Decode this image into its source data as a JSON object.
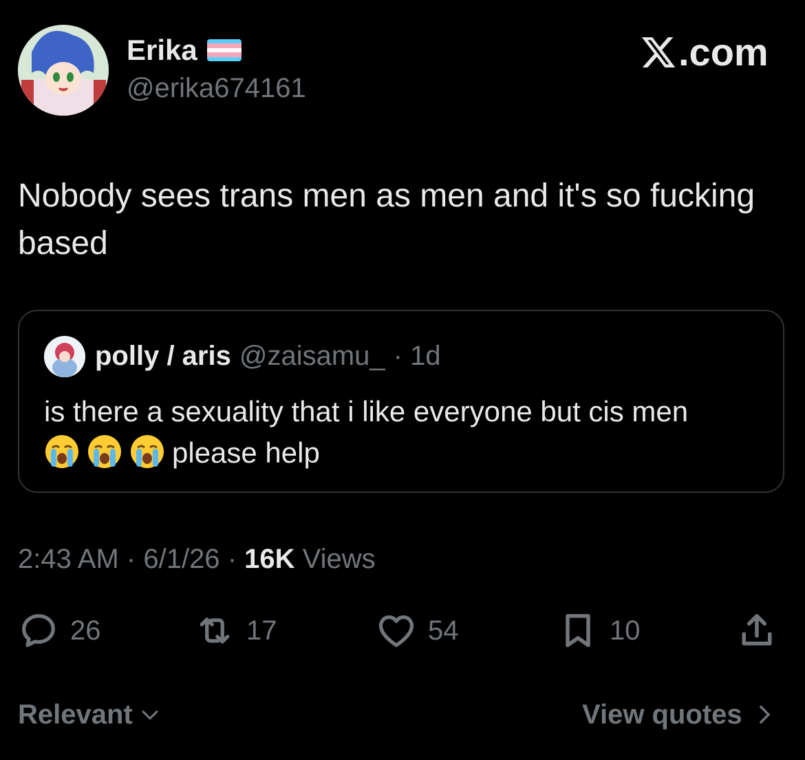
{
  "author": {
    "name": "Erika",
    "handle": "@erika674161",
    "flag_colors": [
      "#5BCEFA",
      "#F5A9B8",
      "#FFFFFF",
      "#F5A9B8",
      "#5BCEFA"
    ]
  },
  "brand": {
    "text": ".com",
    "icon": "x-logo-icon"
  },
  "tweet": {
    "text": "Nobody sees trans men as men and it's so fucking based"
  },
  "quote": {
    "name": "polly / aris",
    "handle": "@zaisamu_",
    "age": "· 1d",
    "text_line1": "is there a sexuality that i like everyone but cis men",
    "text_line2": "please help",
    "emojis": [
      "loudly-crying-face",
      "loudly-crying-face",
      "loudly-crying-face"
    ]
  },
  "meta": {
    "time": "2:43 AM",
    "sep1": "·",
    "date": "6/1/26",
    "sep2": "·",
    "views_count": "16K",
    "views_label": "Views"
  },
  "actions": {
    "replies": "26",
    "reposts": "17",
    "likes": "54",
    "bookmarks": "10"
  },
  "footer": {
    "sort_label": "Relevant",
    "view_quotes_label": "View quotes"
  },
  "colors": {
    "background": "#000000",
    "text_primary": "#e7e9ea",
    "text_secondary": "#71767b",
    "border": "#2f3336"
  }
}
